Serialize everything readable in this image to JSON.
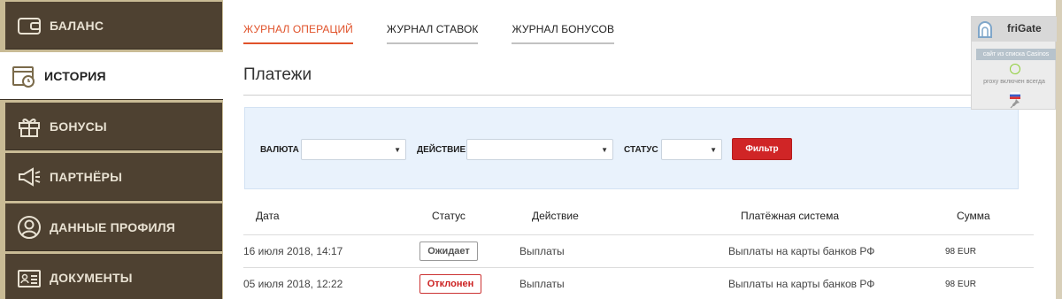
{
  "sidebar": {
    "items": [
      {
        "label": "БАЛАНС",
        "icon": "wallet-icon"
      },
      {
        "label": "ИСТОРИЯ",
        "icon": "calendar-clock-icon"
      },
      {
        "label": "БОНУСЫ",
        "icon": "gift-icon"
      },
      {
        "label": "ПАРТНЁРЫ",
        "icon": "megaphone-icon"
      },
      {
        "label": "ДАННЫЕ ПРОФИЛЯ",
        "icon": "user-icon"
      },
      {
        "label": "ДОКУМЕНТЫ",
        "icon": "id-card-icon"
      }
    ],
    "active_index": 1
  },
  "tabs": [
    {
      "label": "ЖУРНАЛ ОПЕРАЦИЙ",
      "active": true
    },
    {
      "label": "ЖУРНАЛ СТАВОК",
      "active": false
    },
    {
      "label": "ЖУРНАЛ БОНУСОВ",
      "active": false
    }
  ],
  "page_title": "Платежи",
  "filter": {
    "currency_label": "ВАЛЮТА",
    "currency_value": "",
    "action_label": "ДЕЙСТВИЕ",
    "action_value": "",
    "status_label": "СТАТУС",
    "status_value": "",
    "button_label": "Фильтр"
  },
  "table": {
    "headers": [
      "Дата",
      "Статус",
      "Действие",
      "Платёжная система",
      "Сумма"
    ],
    "rows": [
      {
        "date": "16 июля 2018, 14:17",
        "status": "Ожидает",
        "action": "Выплаты",
        "system": "Выплаты на карты банков РФ",
        "amount": "98 EUR"
      },
      {
        "date": "05 июля 2018, 12:22",
        "status": "Отклонен",
        "action": "Выплаты",
        "system": "Выплаты на карты банков РФ",
        "amount": "98 EUR"
      }
    ]
  },
  "frigate": {
    "name": "friGate",
    "site_note": "сайт из списка Casinos",
    "proxy_note": "proxy включен всегда"
  },
  "colors": {
    "sidebar_bg": "#4e4131",
    "accent_orange": "#e0522a",
    "filter_button": "#d02526",
    "status_declined": "#cc2222"
  }
}
